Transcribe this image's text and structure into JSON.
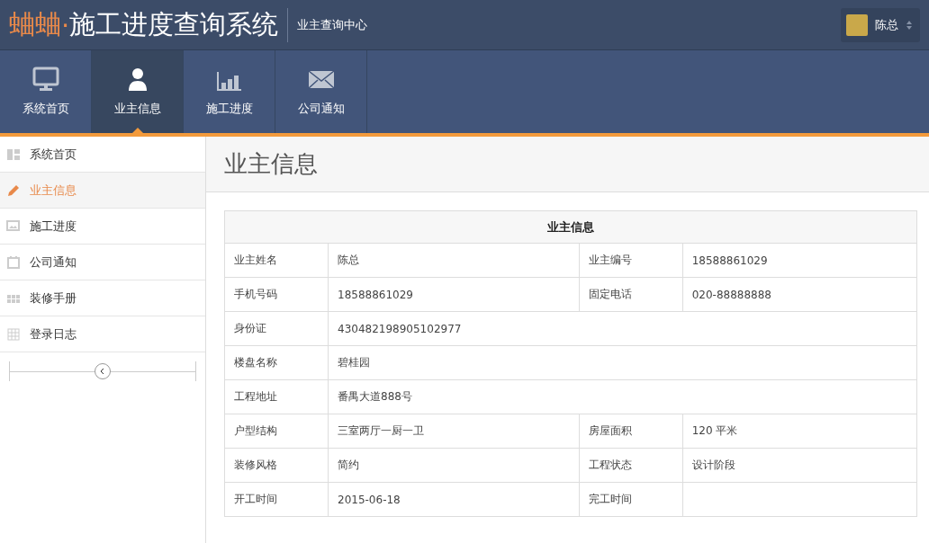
{
  "header": {
    "brand_accent": "蛐蛐",
    "brand_dot": "·",
    "brand_title": "施工进度查询系统",
    "subtitle": "业主查询中心",
    "user": {
      "name": "陈总"
    }
  },
  "nav": [
    {
      "label": "系统首页",
      "selected": false
    },
    {
      "label": "业主信息",
      "selected": true
    },
    {
      "label": "施工进度",
      "selected": false
    },
    {
      "label": "公司通知",
      "selected": false
    }
  ],
  "sidebar": {
    "items": [
      {
        "label": "系统首页",
        "selected": false
      },
      {
        "label": "业主信息",
        "selected": true
      },
      {
        "label": "施工进度",
        "selected": false
      },
      {
        "label": "公司通知",
        "selected": false
      },
      {
        "label": "装修手册",
        "selected": false
      },
      {
        "label": "登录日志",
        "selected": false
      }
    ]
  },
  "page_title": "业主信息",
  "table": {
    "title": "业主信息",
    "rows": [
      [
        {
          "label": "业主姓名",
          "value": "陈总"
        },
        {
          "label": "业主编号",
          "value": "18588861029"
        }
      ],
      [
        {
          "label": "手机号码",
          "value": "18588861029"
        },
        {
          "label": "固定电话",
          "value": "020-88888888"
        }
      ],
      [
        {
          "label": "身份证",
          "value": "430482198905102977"
        }
      ],
      [
        {
          "label": "楼盘名称",
          "value": "碧桂园"
        }
      ],
      [
        {
          "label": "工程地址",
          "value": "番禺大道888号"
        }
      ],
      [
        {
          "label": "户型结构",
          "value": "三室两厅一厨一卫"
        },
        {
          "label": "房屋面积",
          "value": "120 平米"
        }
      ],
      [
        {
          "label": "装修风格",
          "value": "简约"
        },
        {
          "label": "工程状态",
          "value": "设计阶段"
        }
      ],
      [
        {
          "label": "开工时间",
          "value": "2015-06-18"
        },
        {
          "label": "完工时间"
        }
      ]
    ]
  }
}
